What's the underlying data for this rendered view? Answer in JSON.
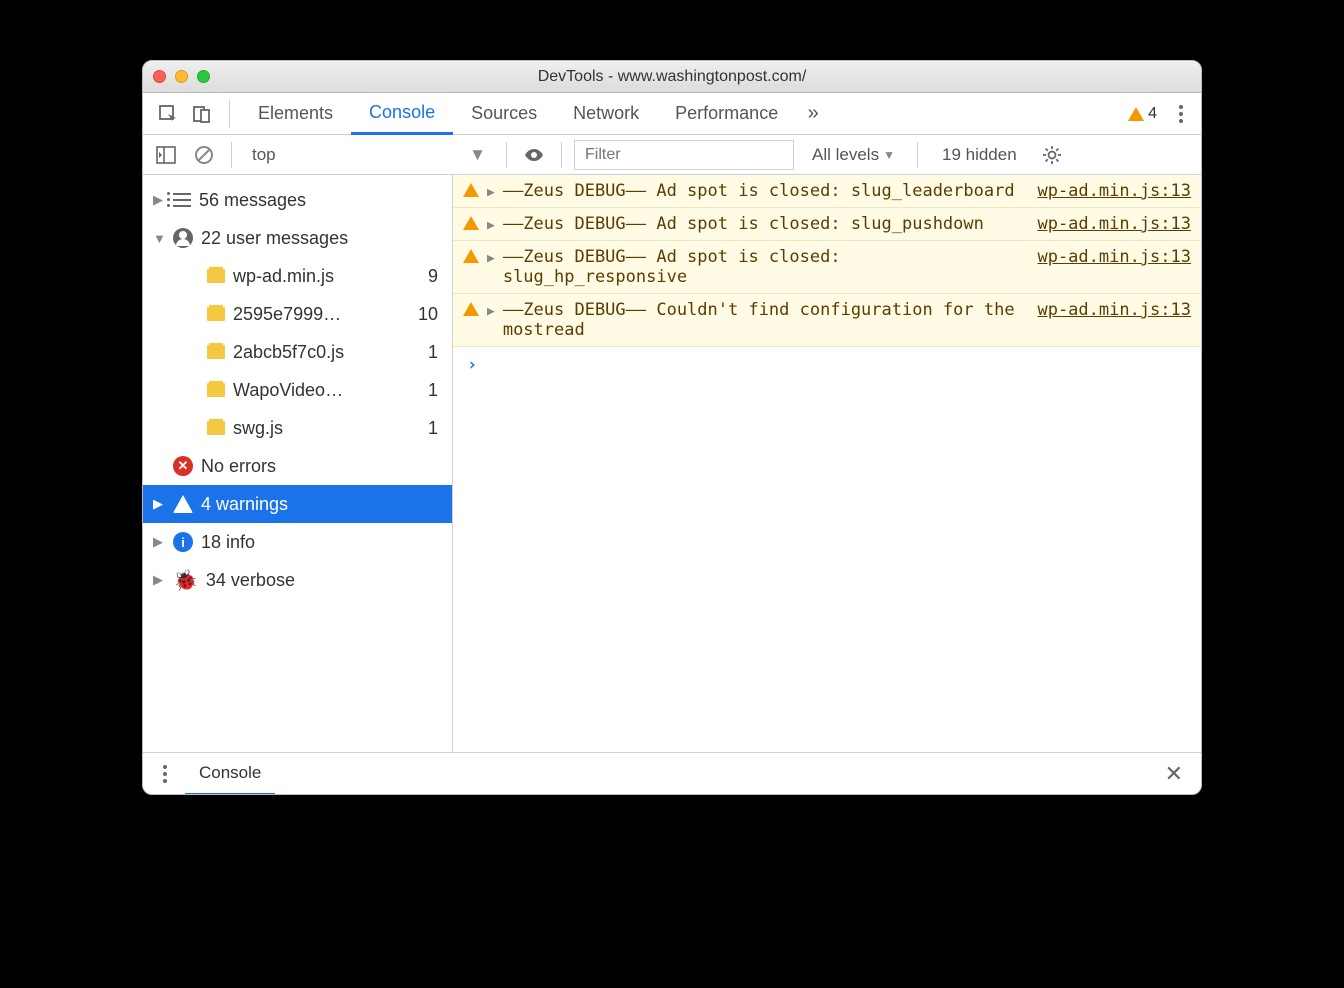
{
  "window": {
    "title": "DevTools - www.washingtonpost.com/"
  },
  "tabs": {
    "items": [
      "Elements",
      "Console",
      "Sources",
      "Network",
      "Performance"
    ],
    "activeIndex": 1,
    "warnCount": "4"
  },
  "toolbar": {
    "context": "top",
    "filterPlaceholder": "Filter",
    "levels": "All levels",
    "hidden": "19 hidden"
  },
  "sidebar": {
    "messages": {
      "label": "56 messages"
    },
    "userMessages": {
      "label": "22 user messages",
      "files": [
        {
          "name": "wp-ad.min.js",
          "count": "9"
        },
        {
          "name": "2595e7999…",
          "count": "10"
        },
        {
          "name": "2abcb5f7c0.js",
          "count": "1"
        },
        {
          "name": "WapoVideo…",
          "count": "1"
        },
        {
          "name": "swg.js",
          "count": "1"
        }
      ]
    },
    "errors": {
      "label": "No errors"
    },
    "warnings": {
      "label": "4 warnings"
    },
    "info": {
      "label": "18 info"
    },
    "verbose": {
      "label": "34 verbose"
    }
  },
  "console": {
    "messages": [
      {
        "text": "––Zeus DEBUG–– Ad spot is closed: slug_leaderboard",
        "source": "wp-ad.min.js:13"
      },
      {
        "text": "––Zeus DEBUG–– Ad spot is closed: slug_pushdown",
        "source": "wp-ad.min.js:13"
      },
      {
        "text": "––Zeus DEBUG–– Ad spot is closed: slug_hp_responsive",
        "source": "wp-ad.min.js:13"
      },
      {
        "text": "––Zeus DEBUG–– Couldn't find configuration for the mostread",
        "source": "wp-ad.min.js:13"
      }
    ]
  },
  "drawer": {
    "tab": "Console"
  }
}
